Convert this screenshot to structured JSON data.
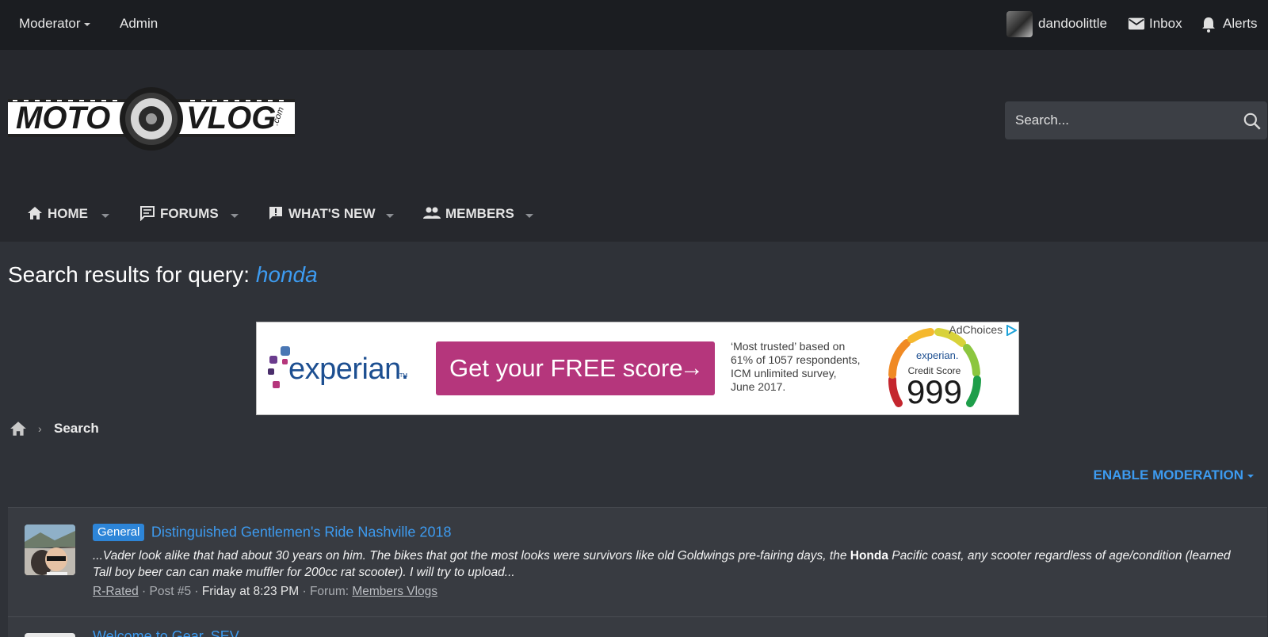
{
  "topbar": {
    "moderator": "Moderator",
    "admin": "Admin",
    "username": "dandoolittle",
    "inbox": "Inbox",
    "alerts": "Alerts"
  },
  "header": {
    "logo_text_left": "MOTO",
    "logo_text_right": "VLOG",
    "logo_text_com": ".com",
    "search_placeholder": "Search..."
  },
  "nav": {
    "items": [
      {
        "label": "HOME",
        "icon": "home-icon"
      },
      {
        "label": "FORUMS",
        "icon": "forum-icon"
      },
      {
        "label": "WHAT'S NEW",
        "icon": "whats-new-icon"
      },
      {
        "label": "MEMBERS",
        "icon": "members-icon"
      }
    ]
  },
  "page": {
    "title_prefix": "Search results for query:",
    "query": "honda"
  },
  "ad": {
    "brand": "experian.",
    "button_label": "Get your FREE score",
    "note_lines": [
      "‘Most trusted’ based on",
      "61% of 1057 respondents,",
      "ICM unlimited survey,",
      "June 2017."
    ],
    "gauge_brand": "experian.",
    "gauge_label": "Credit Score",
    "gauge_score": "999",
    "adchoices": "AdChoices"
  },
  "breadcrumb": {
    "current": "Search"
  },
  "moderation": {
    "label": "ENABLE MODERATION"
  },
  "results": [
    {
      "badge": "General",
      "title": "Distinguished Gentlemen's Ride Nashville 2018",
      "snippet_before": "...Vader look alike that had about 30 years on him. The bikes that got the most looks were survivors like old Goldwings pre-fairing days, the ",
      "snippet_highlight": "Honda",
      "snippet_after": " Pacific coast, any scooter regardless of age/condition (learned Tall boy beer can can make muffler for 200cc rat scooter). I will try to upload...",
      "author": "R-Rated",
      "post": "Post #5",
      "date": "Friday at 8:23 PM",
      "forum_prefix": "Forum:",
      "forum": "Members Vlogs"
    },
    {
      "title": "Welcome to Gear, SEV"
    }
  ],
  "colors": {
    "accent": "#3d9bf0",
    "topbar_bg": "#1b1d21",
    "header_bg": "#26282d",
    "body_bg": "#2f3238",
    "ad_button": "#b5367c"
  }
}
